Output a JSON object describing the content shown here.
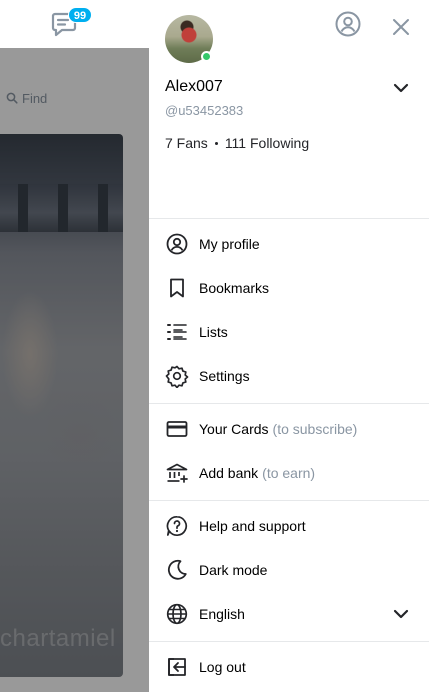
{
  "topbar": {
    "messages_badge": "99"
  },
  "background": {
    "search_placeholder": "Find",
    "watermark": "chartamiel"
  },
  "profile": {
    "username": "Alex007",
    "handle": "@u53452383",
    "fans": "7 Fans",
    "following": "111 Following",
    "online_color": "#35c86a"
  },
  "menu": {
    "section1": [
      {
        "label": "My profile",
        "icon": "profile-icon"
      },
      {
        "label": "Bookmarks",
        "icon": "bookmark-icon"
      },
      {
        "label": "Lists",
        "icon": "lists-icon"
      },
      {
        "label": "Settings",
        "icon": "gear-icon"
      }
    ],
    "section2": [
      {
        "label": "Your Cards",
        "hint": "(to subscribe)",
        "icon": "card-icon"
      },
      {
        "label": "Add bank",
        "hint": "(to earn)",
        "icon": "bank-icon"
      }
    ],
    "section3": [
      {
        "label": "Help and support",
        "icon": "help-icon"
      },
      {
        "label": "Dark mode",
        "icon": "moon-icon"
      },
      {
        "label": "English",
        "icon": "globe-icon"
      }
    ],
    "logout": {
      "label": "Log out",
      "icon": "logout-icon"
    }
  },
  "colors": {
    "accent": "#00aff0",
    "muted": "#8a96a3",
    "icon": "#8a96a3"
  }
}
